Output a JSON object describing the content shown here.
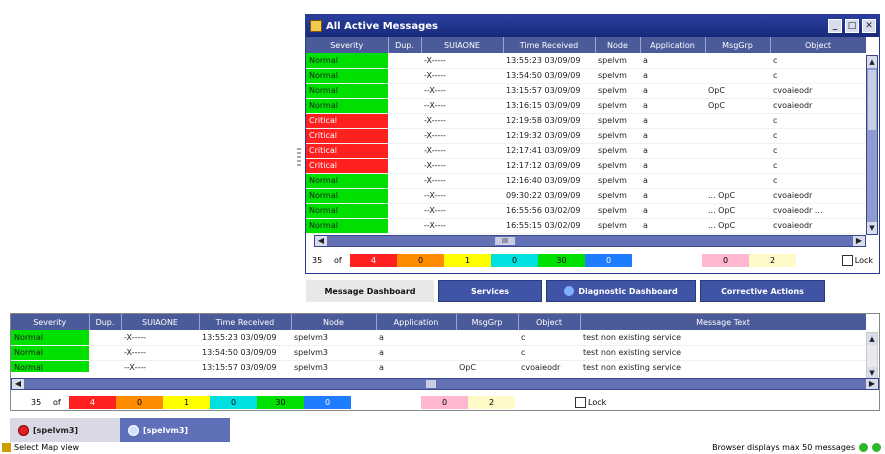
{
  "window": {
    "title": "All Active Messages",
    "controls": [
      "_",
      "□",
      "✕"
    ]
  },
  "top_table": {
    "columns": [
      "Severity",
      "Dup.",
      "SUIAONE",
      "Time Received",
      "Node",
      "Application",
      "MsgGrp",
      "Object"
    ],
    "rows": [
      {
        "severity": "Normal",
        "color": "#00e000",
        "dup": "",
        "flags": "-X-----",
        "time": "13:55:23 03/09/09",
        "node": "spelvm",
        "app": "a",
        "grp": "",
        "obj": "c"
      },
      {
        "severity": "Normal",
        "color": "#00e000",
        "dup": "",
        "flags": "-X-----",
        "time": "13:54:50 03/09/09",
        "node": "spelvm",
        "app": "a",
        "grp": "",
        "obj": "c"
      },
      {
        "severity": "Normal",
        "color": "#00e000",
        "dup": "",
        "flags": "--X----",
        "time": "13:15:57 03/09/09",
        "node": "spelvm",
        "app": "a",
        "grp": "OpC",
        "obj": "cvoaieodr"
      },
      {
        "severity": "Normal",
        "color": "#00e000",
        "dup": "",
        "flags": "--X----",
        "time": "13:16:15 03/09/09",
        "node": "spelvm",
        "app": "a",
        "grp": "OpC",
        "obj": "cvoaieodr"
      },
      {
        "severity": "Critical",
        "color": "#ff2020",
        "dup": "",
        "flags": "-X-----",
        "time": "12:19:58 03/09/09",
        "node": "spelvm",
        "app": "a",
        "grp": "",
        "obj": "c"
      },
      {
        "severity": "Critical",
        "color": "#ff2020",
        "dup": "",
        "flags": "-X-----",
        "time": "12:19:32 03/09/09",
        "node": "spelvm",
        "app": "a",
        "grp": "",
        "obj": "c"
      },
      {
        "severity": "Critical",
        "color": "#ff2020",
        "dup": "",
        "flags": "-X-----",
        "time": "12:17:41 03/09/09",
        "node": "spelvm",
        "app": "a",
        "grp": "",
        "obj": "c"
      },
      {
        "severity": "Critical",
        "color": "#ff2020",
        "dup": "",
        "flags": "-X-----",
        "time": "12:17:12 03/09/09",
        "node": "spelvm",
        "app": "a",
        "grp": "",
        "obj": "c"
      },
      {
        "severity": "Normal",
        "color": "#00e000",
        "dup": "",
        "flags": "-X-----",
        "time": "12:16:40 03/09/09",
        "node": "spelvm",
        "app": "a",
        "grp": "",
        "obj": "c"
      },
      {
        "severity": "Normal",
        "color": "#00e000",
        "dup": "",
        "flags": "--X----",
        "time": "09:30:22 03/09/09",
        "node": "spelvm",
        "app": "a",
        "grp": "... OpC",
        "obj": "cvoaieodr"
      },
      {
        "severity": "Normal",
        "color": "#00e000",
        "dup": "",
        "flags": "--X----",
        "time": "16:55:56 03/02/09",
        "node": "spelvm",
        "app": "a",
        "grp": "... OpC",
        "obj": "cvoaieodr ..."
      },
      {
        "severity": "Normal",
        "color": "#00e000",
        "dup": "",
        "flags": "--X----",
        "time": "16:55:15 03/02/09",
        "node": "spelvm",
        "app": "a",
        "grp": "... OpC",
        "obj": "cvoaieodr"
      }
    ],
    "scroll_marker": "III"
  },
  "top_counts": {
    "total": "35",
    "of_label": "of",
    "cells": [
      {
        "value": "4",
        "color": "#ff2020",
        "text_color": "#ffffff"
      },
      {
        "value": "0",
        "color": "#ff8c00",
        "text_color": "#000000"
      },
      {
        "value": "1",
        "color": "#ffff00",
        "text_color": "#000000"
      },
      {
        "value": "0",
        "color": "#00e0e0",
        "text_color": "#000000"
      },
      {
        "value": "30",
        "color": "#00e000",
        "text_color": "#000000"
      },
      {
        "value": "0",
        "color": "#1e7cff",
        "text_color": "#ffffff"
      },
      {
        "value": "0",
        "color": "#ffb6d0",
        "text_color": "#000000"
      },
      {
        "value": "2",
        "color": "#fffac8",
        "text_color": "#000000"
      }
    ],
    "lock_label": "Lock"
  },
  "top_tabs": [
    {
      "label": "Message Dashboard",
      "active": true
    },
    {
      "label": "Services",
      "active": false
    },
    {
      "label": "Diagnostic Dashboard",
      "active": false
    },
    {
      "label": "Corrective Actions",
      "active": false
    }
  ],
  "bottom_table": {
    "columns": [
      "Severity",
      "Dup.",
      "SUIAONE",
      "Time Received",
      "Node",
      "Application",
      "MsgGrp",
      "Object",
      "Message Text"
    ],
    "rows": [
      {
        "severity": "Normal",
        "color": "#00e000",
        "dup": "",
        "flags": "-X-----",
        "time": "13:55:23 03/09/09",
        "node": "spelvm3",
        "app": "a",
        "grp": "",
        "obj": "c",
        "text": "test non existing service"
      },
      {
        "severity": "Normal",
        "color": "#00e000",
        "dup": "",
        "flags": "-X-----",
        "time": "13:54:50 03/09/09",
        "node": "spelvm3",
        "app": "a",
        "grp": "",
        "obj": "c",
        "text": "test non existing service"
      },
      {
        "severity": "Normal",
        "color": "#00e000",
        "dup": "",
        "flags": "--X----",
        "time": "13:15:57 03/09/09",
        "node": "spelvm3",
        "app": "a",
        "grp": "OpC",
        "obj": "cvoaieodr",
        "text": "test non existing service"
      }
    ]
  },
  "bottom_counts": {
    "total": "35",
    "of_label": "of",
    "cells": [
      {
        "value": "4",
        "color": "#ff2020",
        "text_color": "#ffffff"
      },
      {
        "value": "0",
        "color": "#ff8c00",
        "text_color": "#000000"
      },
      {
        "value": "1",
        "color": "#ffff00",
        "text_color": "#000000"
      },
      {
        "value": "0",
        "color": "#00e0e0",
        "text_color": "#000000"
      },
      {
        "value": "30",
        "color": "#00e000",
        "text_color": "#000000"
      },
      {
        "value": "0",
        "color": "#1e7cff",
        "text_color": "#ffffff"
      },
      {
        "value": "0",
        "color": "#ffb6d0",
        "text_color": "#000000"
      },
      {
        "value": "2",
        "color": "#fffac8",
        "text_color": "#000000"
      }
    ],
    "lock_label": "Lock"
  },
  "bottom_tabs": [
    {
      "label": "[spelvm3]",
      "icon": "critical-status-icon",
      "active": true
    },
    {
      "label": "[spelvm3]",
      "icon": "normal-status-icon",
      "active": false
    }
  ],
  "status": {
    "left": "Select Map view",
    "right": "Browser displays max 50 messages"
  }
}
